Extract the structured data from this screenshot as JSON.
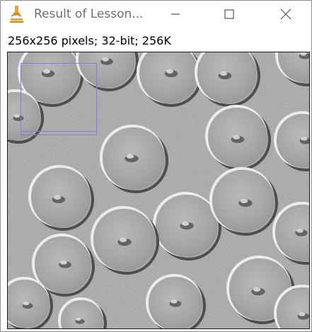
{
  "window": {
    "title": "Result of Lesson...",
    "minimize_label": "Minimize",
    "maximize_label": "Maximize",
    "close_label": "Close"
  },
  "image_info": "256x256 pixels; 32-bit; 256K",
  "image": {
    "description_icon": "microscope-icon",
    "style": "embossed grayscale micrograph with circular cells",
    "selection": "rectangle ROI"
  },
  "colors": {
    "roi": "#7c7cf0",
    "background": "#a7a7a7",
    "titlebar_text": "#6e6e6e"
  }
}
